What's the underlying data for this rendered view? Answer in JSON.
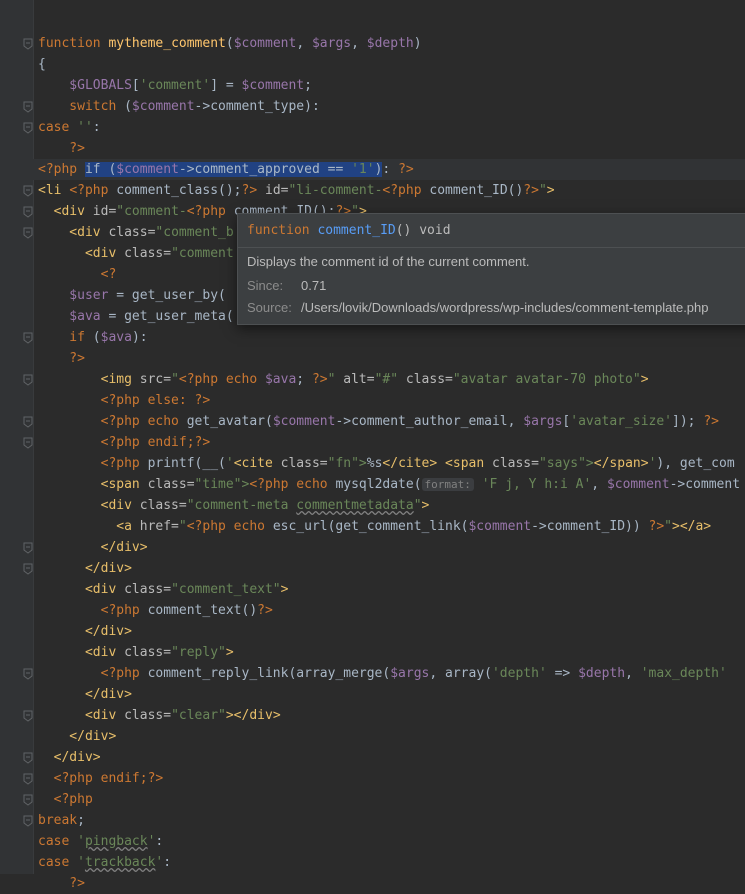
{
  "code_lines": [
    [],
    [
      [
        "kw",
        "function "
      ],
      [
        "fn",
        "mytheme_comment"
      ],
      [
        "plain",
        "("
      ],
      [
        "var",
        "$comment"
      ],
      [
        "plain",
        ", "
      ],
      [
        "var",
        "$args"
      ],
      [
        "plain",
        ", "
      ],
      [
        "var",
        "$depth"
      ],
      [
        "plain",
        ")"
      ]
    ],
    [
      [
        "plain",
        "{"
      ]
    ],
    [
      [
        "var",
        "    $GLOBALS"
      ],
      [
        "plain",
        "["
      ],
      [
        "str",
        "'comment'"
      ],
      [
        "plain",
        "] = "
      ],
      [
        "var",
        "$comment"
      ],
      [
        "plain",
        ";"
      ]
    ],
    [
      [
        "kw",
        "    switch "
      ],
      [
        "plain",
        "("
      ],
      [
        "var",
        "$comment"
      ],
      [
        "plain",
        "->"
      ],
      [
        "plain",
        "comment_type"
      ],
      [
        "plain",
        "):"
      ]
    ],
    [
      [
        "kw",
        "case "
      ],
      [
        "str",
        "''"
      ],
      [
        "plain",
        ":"
      ]
    ],
    [
      [
        "php",
        "    ?>"
      ]
    ],
    [
      [
        "php",
        "<?php "
      ],
      [
        "sel",
        "if ("
      ],
      [
        "selvar",
        "$comment"
      ],
      [
        "sel",
        "->comment_approved == "
      ],
      [
        "selstr",
        "'1'"
      ],
      [
        "sel",
        ")"
      ],
      [
        "plain",
        ": "
      ],
      [
        "php",
        "?>"
      ]
    ],
    [
      [
        "tag",
        "<li "
      ],
      [
        "php",
        "<?php "
      ],
      [
        "plain",
        "comment_class();"
      ],
      [
        "php",
        "?> "
      ],
      [
        "attr",
        "id="
      ],
      [
        "str",
        "\"li-comment-"
      ],
      [
        "php",
        "<?php "
      ],
      [
        "plain",
        "comment_ID()"
      ],
      [
        "php",
        "?>"
      ],
      [
        "str",
        "\""
      ],
      [
        "tag",
        ">"
      ]
    ],
    [
      [
        "tag",
        "  <div "
      ],
      [
        "attr",
        "id="
      ],
      [
        "str",
        "\"comment-"
      ],
      [
        "php",
        "<?php "
      ],
      [
        "plain",
        "comment_ID();"
      ],
      [
        "php",
        "?>"
      ],
      [
        "str",
        "\""
      ],
      [
        "tag",
        ">"
      ]
    ],
    [
      [
        "tag",
        "    <div "
      ],
      [
        "attr",
        "class="
      ],
      [
        "str",
        "\"comment_b"
      ]
    ],
    [
      [
        "tag",
        "      <div "
      ],
      [
        "attr",
        "class="
      ],
      [
        "str",
        "\"comment"
      ]
    ],
    [
      [
        "php",
        "        <?"
      ]
    ],
    [
      [
        "var",
        "    $user"
      ],
      [
        "plain",
        " = get_user_by( "
      ]
    ],
    [
      [
        "var",
        "    $ava"
      ],
      [
        "plain",
        " = get_user_meta("
      ]
    ],
    [
      [
        "kw",
        "    if "
      ],
      [
        "plain",
        "("
      ],
      [
        "var",
        "$ava"
      ],
      [
        "plain",
        "):"
      ]
    ],
    [
      [
        "php",
        "    ?>"
      ]
    ],
    [
      [
        "tag",
        "        <img "
      ],
      [
        "attr",
        "src="
      ],
      [
        "str",
        "\""
      ],
      [
        "php",
        "<?php echo "
      ],
      [
        "var",
        "$ava"
      ],
      [
        "plain",
        "; "
      ],
      [
        "php",
        "?>"
      ],
      [
        "str",
        "\" "
      ],
      [
        "attr",
        "alt="
      ],
      [
        "str",
        "\"#\" "
      ],
      [
        "attr",
        "class="
      ],
      [
        "str",
        "\"avatar avatar-70 photo\""
      ],
      [
        "tag",
        ">"
      ]
    ],
    [
      [
        "php",
        "        <?php else: ?>"
      ]
    ],
    [
      [
        "php",
        "        <?php echo "
      ],
      [
        "plain",
        "get_avatar("
      ],
      [
        "var",
        "$comment"
      ],
      [
        "plain",
        "->comment_author_email, "
      ],
      [
        "var",
        "$args"
      ],
      [
        "plain",
        "["
      ],
      [
        "str",
        "'avatar_size'"
      ],
      [
        "plain",
        "]); "
      ],
      [
        "php",
        "?>"
      ]
    ],
    [
      [
        "php",
        "        <?php endif;?>"
      ]
    ],
    [
      [
        "php",
        "        <?php "
      ],
      [
        "plain",
        "printf(__("
      ],
      [
        "str",
        "'"
      ],
      [
        "tag",
        "<cite "
      ],
      [
        "attr",
        "class="
      ],
      [
        "str",
        "\"fn\">"
      ],
      [
        "plain",
        "%s"
      ],
      [
        "tag",
        "</cite> <span "
      ],
      [
        "attr",
        "class="
      ],
      [
        "str",
        "\"says\">"
      ],
      [
        "tag",
        "</span>"
      ],
      [
        "str",
        "'"
      ],
      [
        "plain",
        "), get_com"
      ]
    ],
    [
      [
        "tag",
        "        <span "
      ],
      [
        "attr",
        "class="
      ],
      [
        "str",
        "\"time\">"
      ],
      [
        "php",
        "<?php echo "
      ],
      [
        "plain",
        "mysql2date("
      ],
      [
        "hint",
        "format:"
      ],
      [
        "str",
        " 'F j, Y h:i A'"
      ],
      [
        "plain",
        ", "
      ],
      [
        "var",
        "$comment"
      ],
      [
        "plain",
        "->comment"
      ]
    ],
    [
      [
        "tag",
        "        <div "
      ],
      [
        "attr",
        "class="
      ],
      [
        "str",
        "\"comment-meta "
      ],
      [
        "strsq",
        "commentmetadata"
      ],
      [
        "str",
        "\""
      ],
      [
        "tag",
        ">"
      ]
    ],
    [
      [
        "tag",
        "          <a "
      ],
      [
        "attr",
        "href="
      ],
      [
        "str",
        "\""
      ],
      [
        "php",
        "<?php echo "
      ],
      [
        "plain",
        "esc_url(get_comment_link("
      ],
      [
        "var",
        "$comment"
      ],
      [
        "plain",
        "->comment_ID)) "
      ],
      [
        "php",
        "?>"
      ],
      [
        "str",
        "\""
      ],
      [
        "tag",
        "></a>"
      ]
    ],
    [
      [
        "tag",
        "        </div>"
      ]
    ],
    [
      [
        "tag",
        "      </div>"
      ]
    ],
    [
      [
        "tag",
        "      <div "
      ],
      [
        "attr",
        "class="
      ],
      [
        "str",
        "\"comment_text\""
      ],
      [
        "tag",
        ">"
      ]
    ],
    [
      [
        "php",
        "        <?php "
      ],
      [
        "plain",
        "comment_text()"
      ],
      [
        "php",
        "?>"
      ]
    ],
    [
      [
        "tag",
        "      </div>"
      ]
    ],
    [
      [
        "tag",
        "      <div "
      ],
      [
        "attr",
        "class="
      ],
      [
        "str",
        "\"reply\""
      ],
      [
        "tag",
        ">"
      ]
    ],
    [
      [
        "php",
        "        <?php "
      ],
      [
        "plain",
        "comment_reply_link(array_merge("
      ],
      [
        "var",
        "$args"
      ],
      [
        "plain",
        ", array("
      ],
      [
        "str",
        "'depth'"
      ],
      [
        "plain",
        " => "
      ],
      [
        "var",
        "$depth"
      ],
      [
        "plain",
        ", "
      ],
      [
        "str",
        "'max_depth'"
      ]
    ],
    [
      [
        "tag",
        "      </div>"
      ]
    ],
    [
      [
        "tag",
        "      <div "
      ],
      [
        "attr",
        "class="
      ],
      [
        "str",
        "\"clear\""
      ],
      [
        "tag",
        "></div>"
      ]
    ],
    [
      [
        "tag",
        "    </div>"
      ]
    ],
    [
      [
        "tag",
        "  </div>"
      ]
    ],
    [
      [
        "php",
        "  <?php endif;?>"
      ]
    ],
    [
      [
        "php",
        "  <?php"
      ]
    ],
    [
      [
        "kw",
        "break"
      ],
      [
        "plain",
        ";"
      ]
    ],
    [
      [
        "kw",
        "case "
      ],
      [
        "str",
        "'"
      ],
      [
        "strsq",
        "pingback"
      ],
      [
        "str",
        "'"
      ],
      [
        "plain",
        ":"
      ]
    ],
    [
      [
        "kw",
        "case "
      ],
      [
        "str",
        "'"
      ],
      [
        "strsq",
        "trackback"
      ],
      [
        "str",
        "'"
      ],
      [
        "plain",
        ":"
      ]
    ],
    [
      [
        "php",
        "    ?>"
      ]
    ]
  ],
  "fold_lines": [
    1,
    4,
    5,
    8,
    9,
    10,
    15,
    17,
    19,
    20,
    25,
    26,
    31,
    33,
    35,
    36,
    37,
    38
  ],
  "tooltip": {
    "keyword": "function",
    "name": "comment_ID",
    "signature": "() void",
    "description": "Displays the comment id of the current comment.",
    "since_label": "Since:",
    "since_value": "0.71",
    "source_label": "Source:",
    "source_value": "/Users/lovik/Downloads/wordpress/wp-includes/comment-template.php"
  },
  "colors": {
    "background": "#2b2b2b",
    "keyword": "#cc7832",
    "variable": "#9876aa",
    "string": "#6a8759",
    "function": "#ffc66d",
    "tag": "#e8bf6a",
    "selection": "#214283"
  }
}
